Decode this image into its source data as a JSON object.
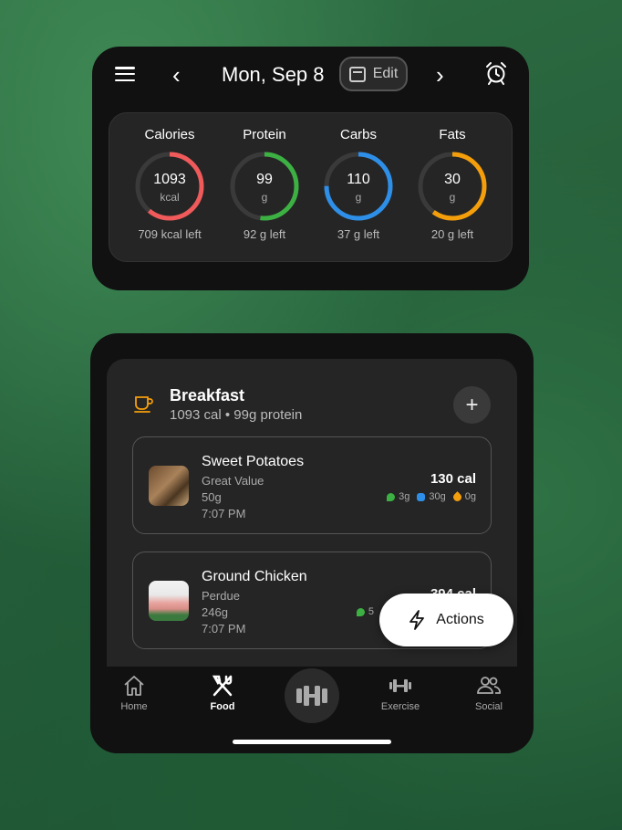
{
  "header": {
    "date": "Mon, Sep 8",
    "edit_label": "Edit",
    "prev_glyph": "‹",
    "next_glyph": "›"
  },
  "macros": [
    {
      "title": "Calories",
      "value": "1093",
      "unit": "kcal",
      "left": "709 kcal left",
      "color": "#f05a5a",
      "progress": 0.61
    },
    {
      "title": "Protein",
      "value": "99",
      "unit": "g",
      "left": "92 g left",
      "color": "#3cb043",
      "progress": 0.52
    },
    {
      "title": "Carbs",
      "value": "110",
      "unit": "g",
      "left": "37 g left",
      "color": "#2e8fe8",
      "progress": 0.75
    },
    {
      "title": "Fats",
      "value": "30",
      "unit": "g",
      "left": "20 g left",
      "color": "#f59e0b",
      "progress": 0.6
    }
  ],
  "meal": {
    "title": "Breakfast",
    "subtitle": "1093 cal • 99g protein",
    "add_glyph": "+"
  },
  "foods": [
    {
      "name": "Sweet Potatoes",
      "brand": "Great Value",
      "qty": "50g",
      "time": "7:07 PM",
      "cal": "130 cal",
      "protein": "3g",
      "carbs": "30g",
      "fat": "0g"
    },
    {
      "name": "Ground Chicken",
      "brand": "Perdue",
      "qty": "246g",
      "time": "7:07 PM",
      "cal": "394 cal",
      "protein": "5",
      "carbs": "",
      "fat": ""
    }
  ],
  "actions_label": "Actions",
  "tabs": [
    {
      "label": "Home",
      "icon": "home-icon"
    },
    {
      "label": "Food",
      "icon": "fork-knife-icon"
    },
    {
      "label": "Exercise",
      "icon": "dumbbell-icon"
    },
    {
      "label": "Social",
      "icon": "people-icon"
    }
  ]
}
